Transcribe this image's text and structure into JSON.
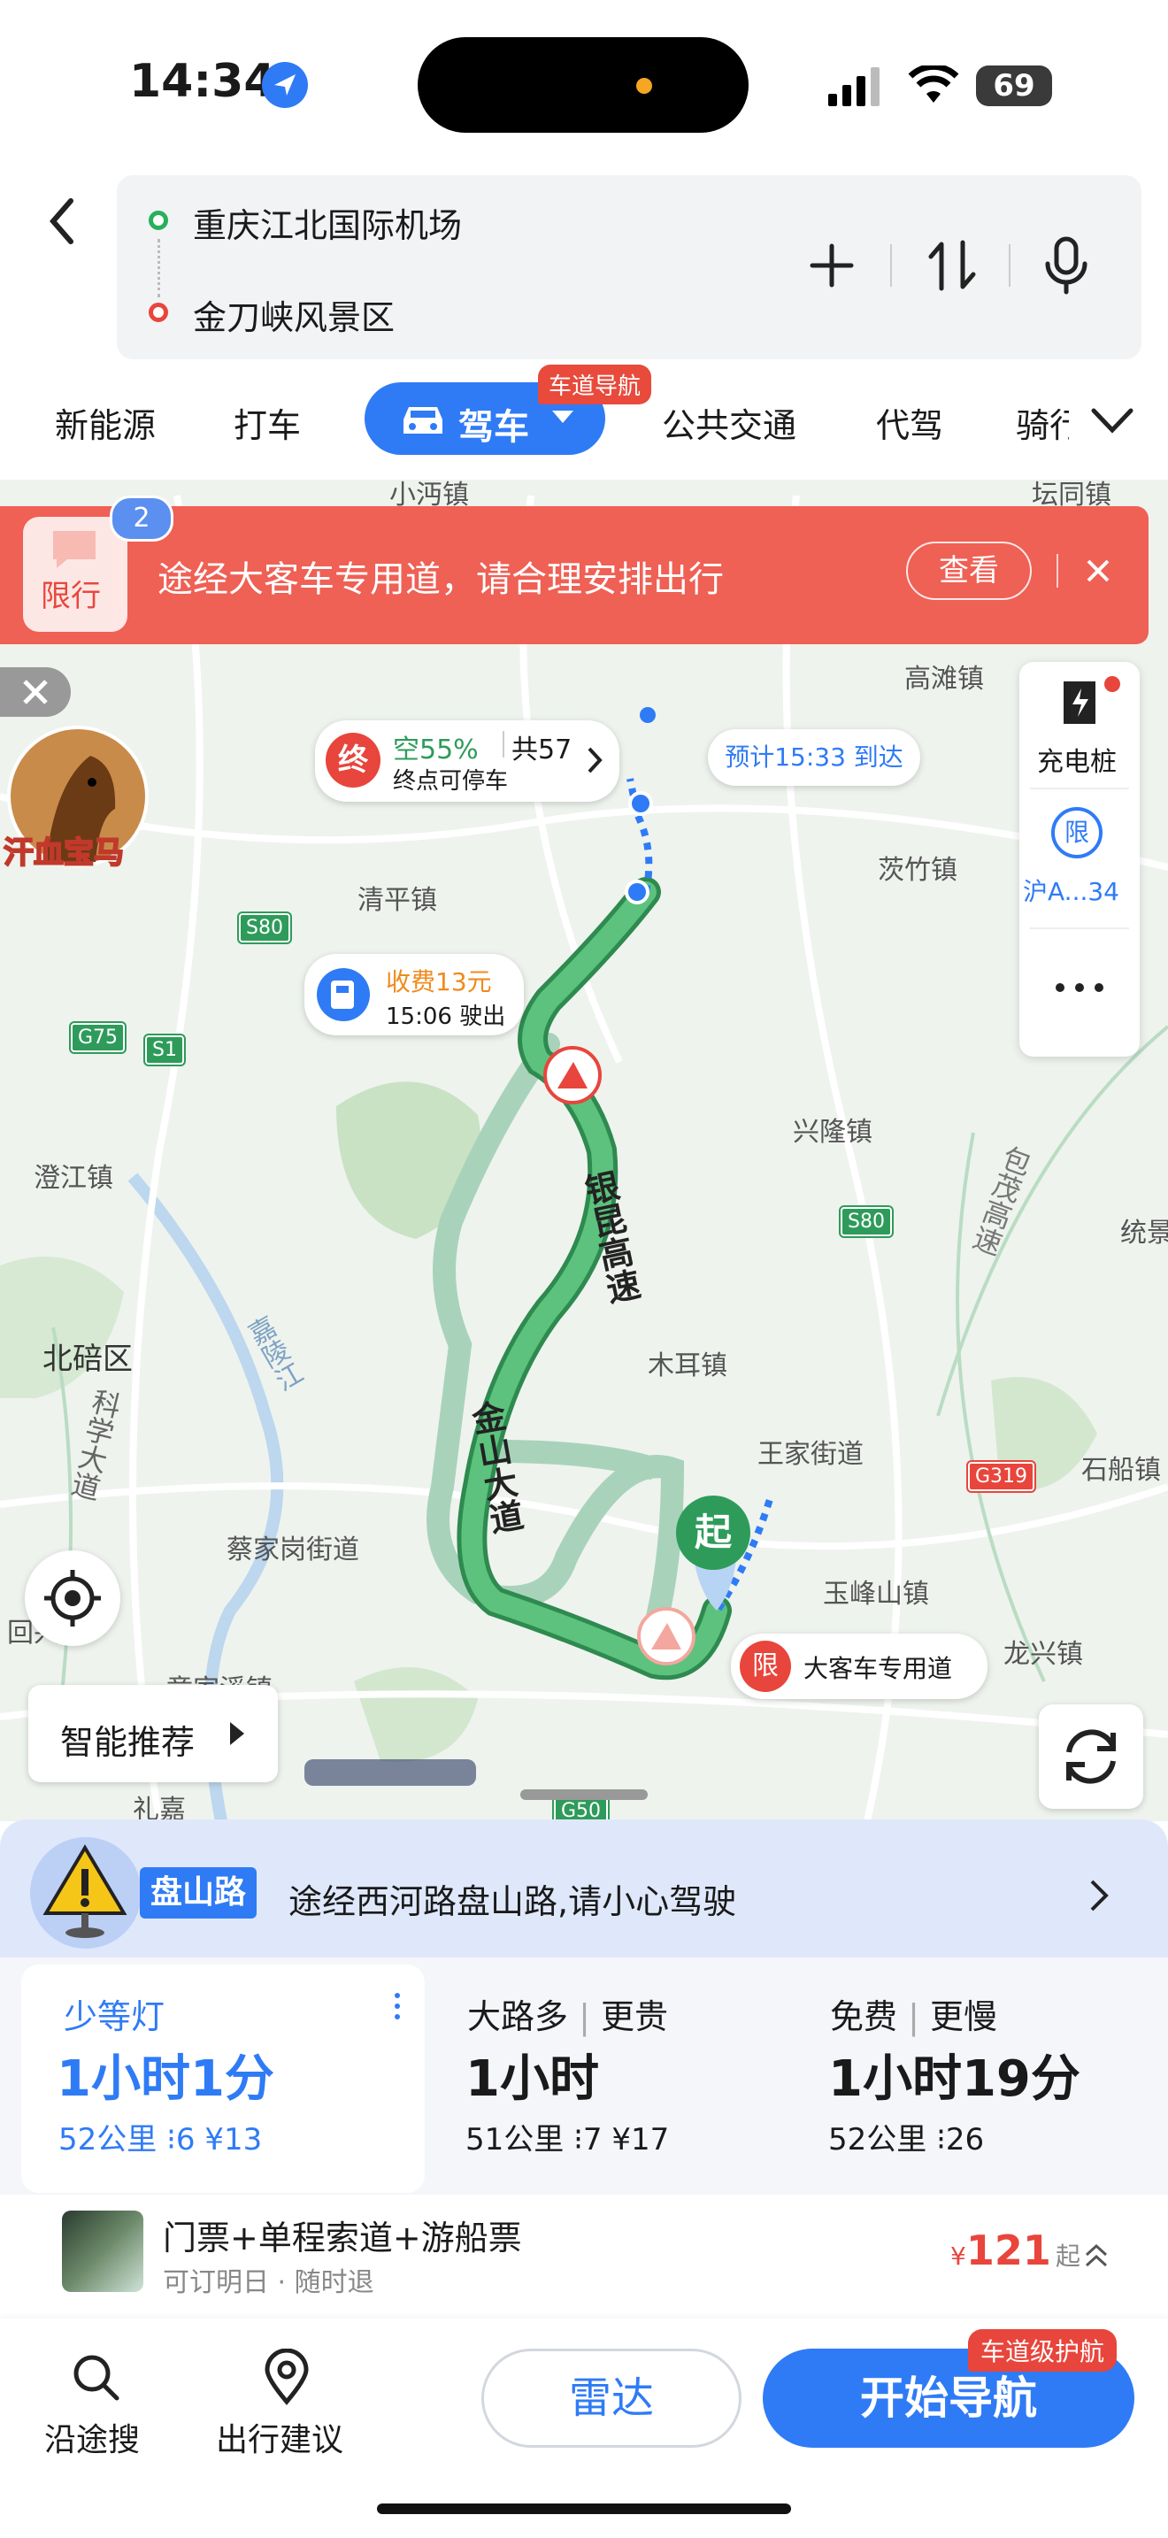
{
  "status_bar": {
    "time": "14:34",
    "battery": "69"
  },
  "route": {
    "origin": "重庆江北国际机场",
    "destination": "金刀峡风景区"
  },
  "mode_tabs": [
    "新能源",
    "打车",
    "驾车",
    "公共交通",
    "代驾",
    "骑行"
  ],
  "active_tab_badge": "车道导航",
  "alert": {
    "icon_label": "限行",
    "count": "2",
    "message": "途经大客车专用道，请合理安排出行",
    "action": "查看"
  },
  "map": {
    "places": [
      "小沔镇",
      "坛同镇",
      "高滩镇",
      "清平镇",
      "茨竹镇",
      "澄江镇",
      "兴隆镇",
      "北碚区",
      "木耳镇",
      "统景",
      "王家街道",
      "石船镇",
      "蔡家岗街道",
      "玉峰山镇",
      "龙兴镇",
      "回兴",
      "童家溪镇",
      "礼嘉"
    ],
    "roads": [
      "银昆高速",
      "金山大道",
      "包茂高速",
      "嘉陵江",
      "科学大道"
    ],
    "shields": [
      "S80",
      "G75",
      "S1",
      "S80",
      "G319",
      "G50"
    ],
    "end_marker": "终",
    "parking": {
      "free": "空55%",
      "total": "共57",
      "note": "终点可停车"
    },
    "eta": "预计15:33 到达",
    "toll": {
      "fee": "收费13元",
      "exit": "15:06 驶出"
    },
    "start_marker": "起",
    "bus_lane": {
      "icon": "限",
      "text": "大客车专用道"
    },
    "mascot_label": "汗血宝马"
  },
  "side_panel": {
    "charging": "充电桩",
    "plate_icon": "限",
    "plate": "沪A...34"
  },
  "smart_recommend": "智能推荐",
  "warning": {
    "tag": "盘山路",
    "text": "途经西河路盘山路,请小心驾驶"
  },
  "routes": [
    {
      "title": "少等灯",
      "time": "1小时1分",
      "distance": "52公里",
      "lights": "6",
      "fee": "¥13"
    },
    {
      "title": "大路多",
      "title2": "更贵",
      "time": "1小时",
      "distance": "51公里",
      "lights": "7",
      "fee": "¥17"
    },
    {
      "title": "免费",
      "title2": "更慢",
      "time": "1小时19分",
      "distance": "52公里",
      "lights": "26",
      "fee": ""
    }
  ],
  "ticket": {
    "title": "门票+单程索道+游船票",
    "sub": "可订明日 · 随时退",
    "price": "121",
    "currency": "¥",
    "suffix": "起"
  },
  "bottom": {
    "search": "沿途搜",
    "advice": "出行建议",
    "radar": "雷达",
    "start": "开始导航",
    "start_badge": "车道级护航"
  },
  "colors": {
    "accent": "#2f7bf6",
    "route": "#3ea563",
    "alert": "#ef6055"
  }
}
